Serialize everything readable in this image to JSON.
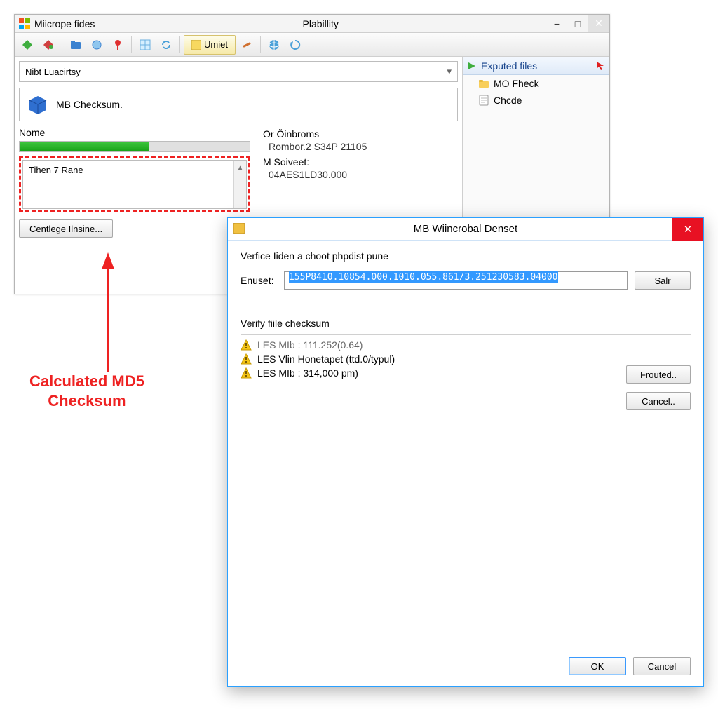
{
  "mainWindow": {
    "appTitle": "Miicrope fides",
    "centerTitle": "Plabillity",
    "toolbar": {
      "umetLabel": "Umiet"
    },
    "locationBarLabel": "Nibt Luacirtsy",
    "breadcrumbText": "MB Checksum.",
    "nameLabel": "Nome",
    "listItem0": "Tihen 7 Rane",
    "centlegeBtn": "Centlege Ilnsine...",
    "infoHeader": "Or Öinbroms",
    "infoLine1": "Rombor.2 S34P 21105",
    "mSoveetLabel": "M Soiveet:",
    "mSoveetValue": "04AES1LD30.000"
  },
  "sidebar": {
    "header": "Exputed files",
    "item0": "MO Fheck",
    "item1": "Chcde"
  },
  "callout": {
    "line1": "Calculated MD5",
    "line2": "Checksum"
  },
  "dialog": {
    "title": "MB Wiincrobal Denset",
    "instruction": "Verfice Iiden a choot phpdist pune",
    "enusetLabel": "Enuset:",
    "enusetValue": "155P8410.10854.000.1010.055.861/3.251230583.04000",
    "salrBtn": "Salr",
    "sectionLabel": "Verify fiile checksum",
    "row0": "LES MIb : 111.252(0.64)",
    "row1": "LES Vlin Honetapet (ttd.0/typul)",
    "row2": "LES MIb : 314,000 pm)",
    "froutedBtn": "Frouted..",
    "cancel2Btn": "Cancel..",
    "okBtn": "OK",
    "cancelBtn": "Cancel"
  }
}
